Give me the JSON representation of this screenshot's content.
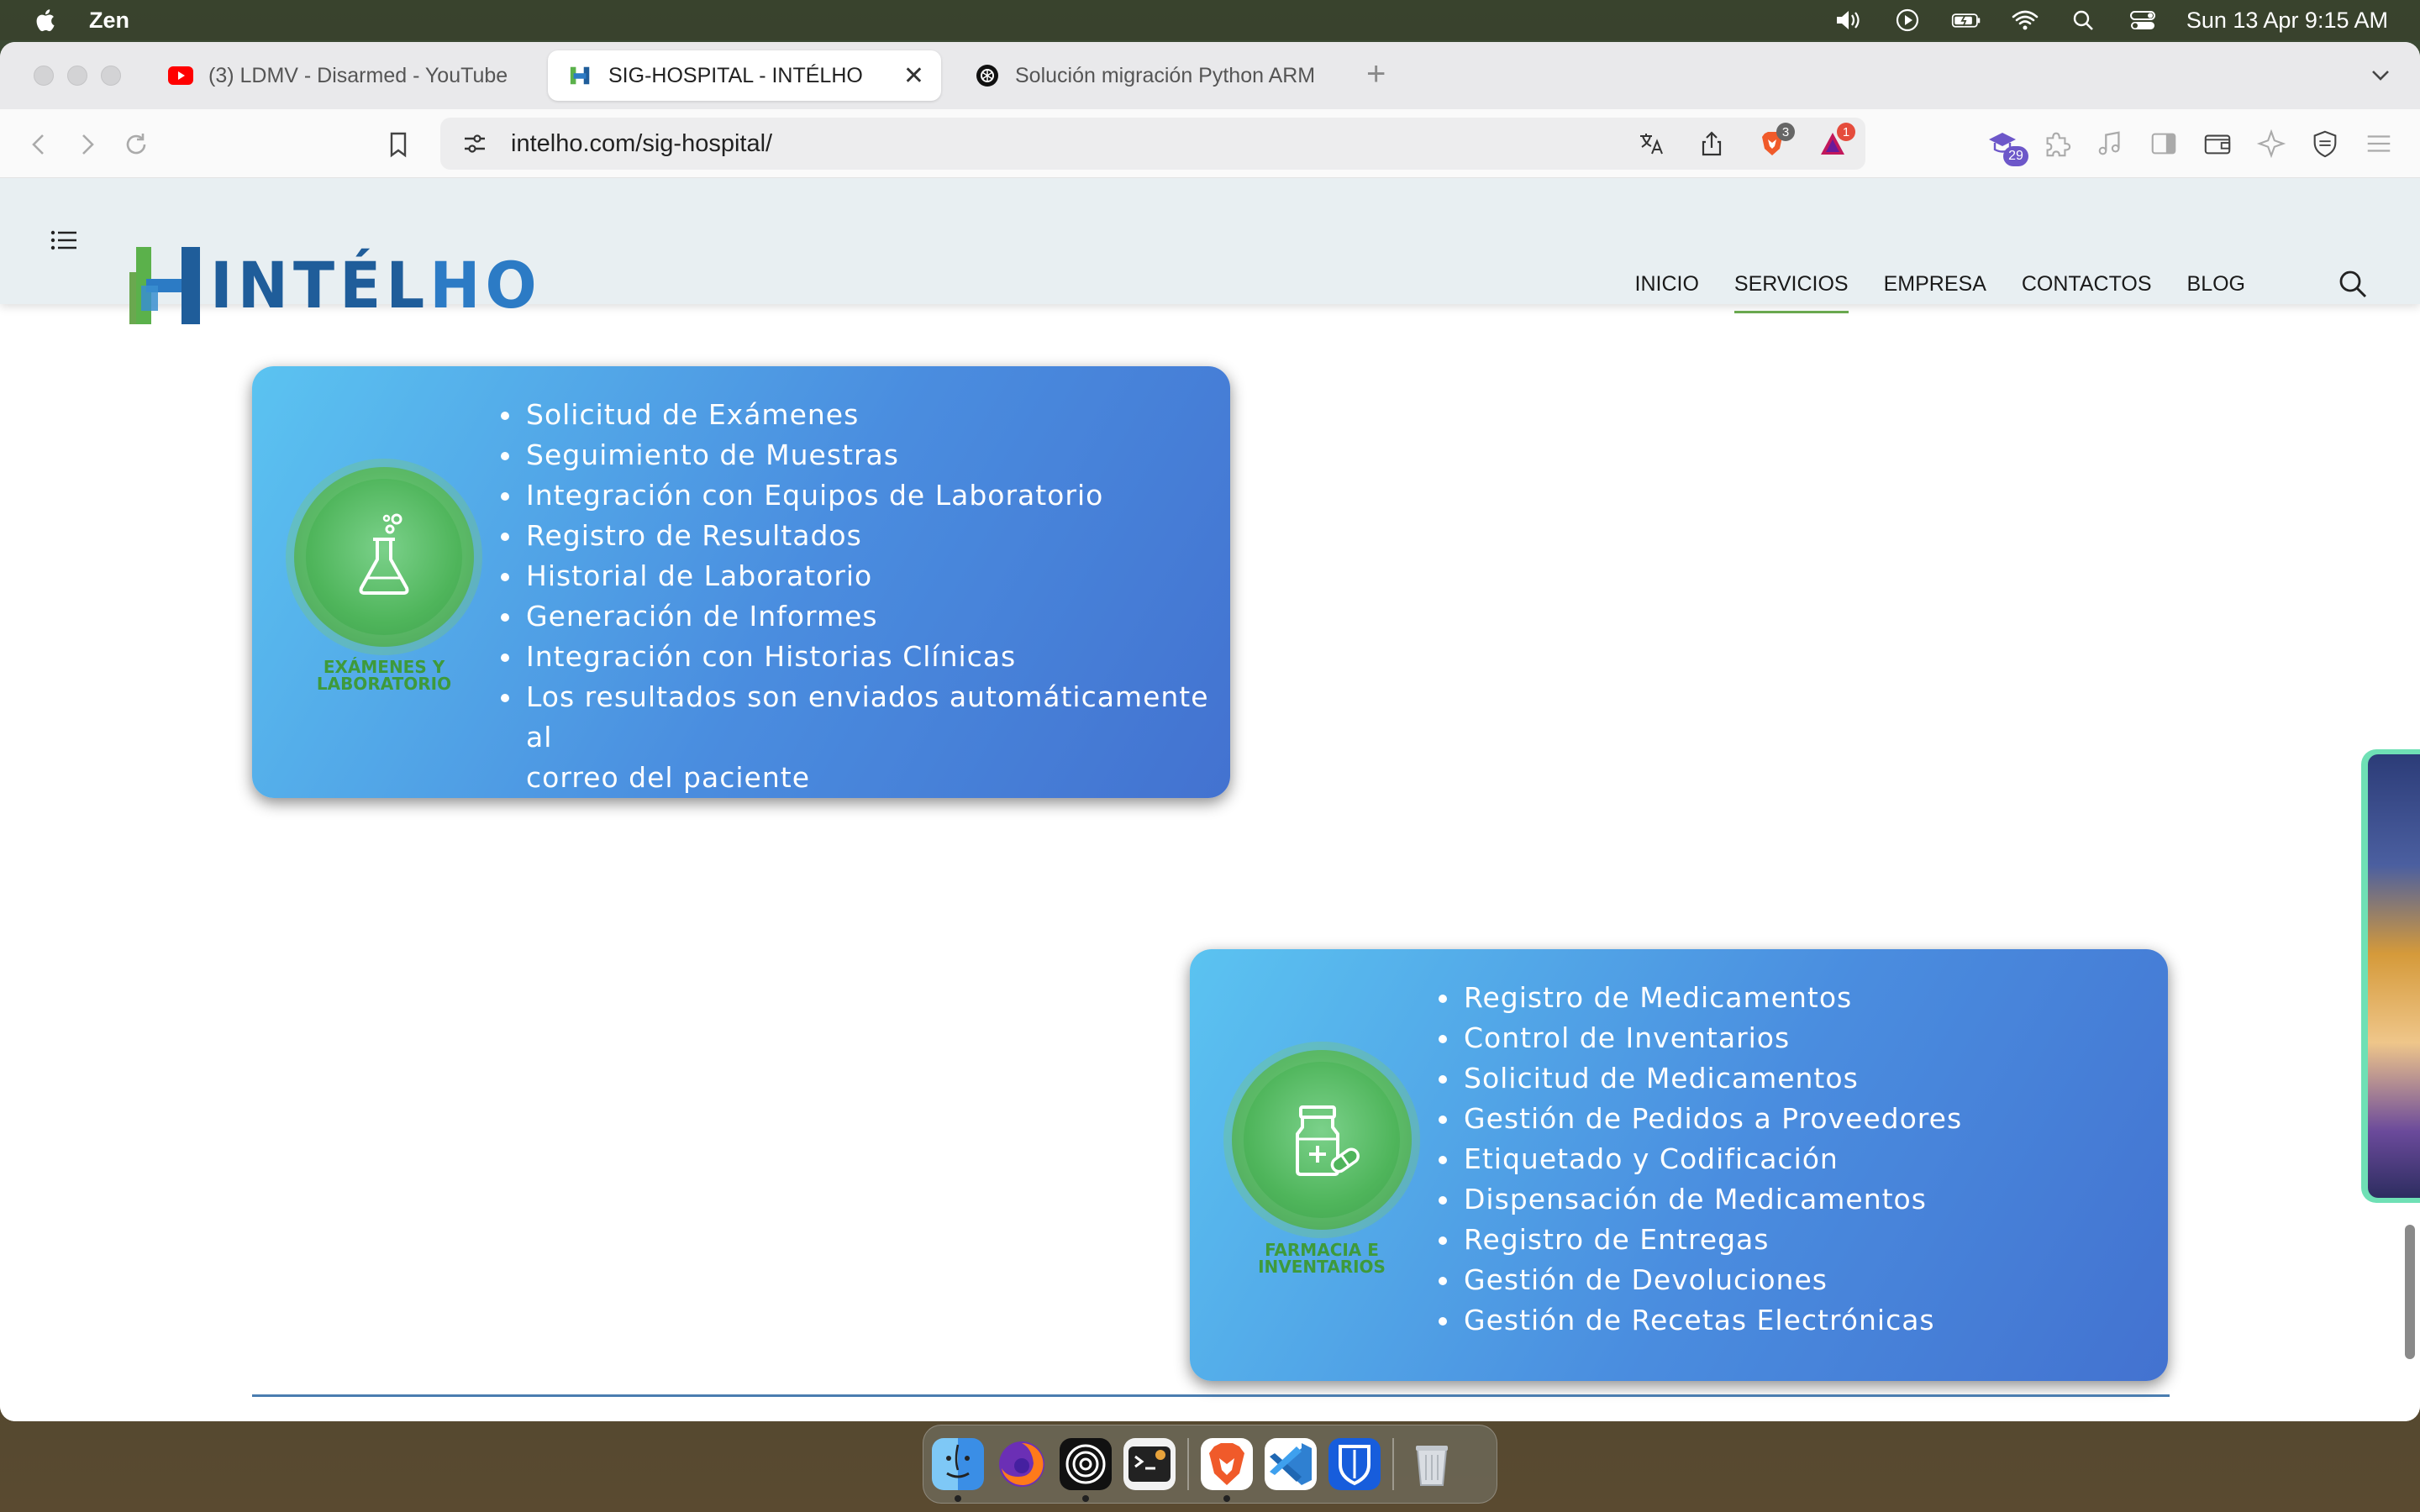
{
  "menubar": {
    "app_name": "Zen",
    "datetime": "Sun 13 Apr  9:15 AM"
  },
  "tabs": [
    {
      "title": "(3) LDMV - Disarmed - YouTube",
      "icon": "youtube-icon"
    },
    {
      "title": "SIG-HOSPITAL - INTÉLHO",
      "icon": "intelho-icon"
    },
    {
      "title": "Solución migración Python ARM",
      "icon": "openai-icon"
    }
  ],
  "address_bar": {
    "url": "intelho.com/sig-hospital/",
    "brave_badge": "3",
    "alert_badge": "1",
    "extension_badge": "29"
  },
  "site": {
    "logo_left": "INTÉL",
    "logo_right": "HO",
    "nav": [
      "INICIO",
      "SERVICIOS",
      "EMPRESA",
      "CONTACTOS",
      "BLOG"
    ],
    "active_nav": "SERVICIOS"
  },
  "cards": [
    {
      "label_line1": "EXÁMENES Y",
      "label_line2": "LABORATORIO",
      "icon": "flask-icon",
      "items": [
        "Solicitud de Exámenes",
        "Seguimiento de Muestras",
        "Integración con Equipos de Laboratorio",
        "Registro de Resultados",
        "Historial de Laboratorio",
        "Generación de Informes",
        "Integración con Historias Clínicas",
        "Los resultados son enviados automáticamente al",
        "correo del paciente"
      ]
    },
    {
      "label_line1": "FARMACIA E",
      "label_line2": "INVENTARIOS",
      "icon": "medicine-bottle-icon",
      "items": [
        "Registro de Medicamentos",
        "Control de Inventarios",
        "Solicitud de Medicamentos",
        "Gestión de Pedidos a Proveedores",
        "Etiquetado y Codificación",
        "Dispensación de Medicamentos",
        "Registro de Entregas",
        "Gestión de Devoluciones",
        "Gestión de Recetas Electrónicas"
      ]
    }
  ],
  "colors": {
    "card_gradient_start": "#5bc3f1",
    "card_gradient_end": "#4372d0",
    "emblem_green": "#4fb55b",
    "brand_blue": "#1f5d9a",
    "nav_underline": "#6aa84f"
  },
  "dock": [
    "finder-icon",
    "firefox-icon",
    "podcast-icon",
    "terminal-icon",
    "brave-icon",
    "vscode-icon",
    "bitwarden-icon",
    "trash-icon"
  ]
}
